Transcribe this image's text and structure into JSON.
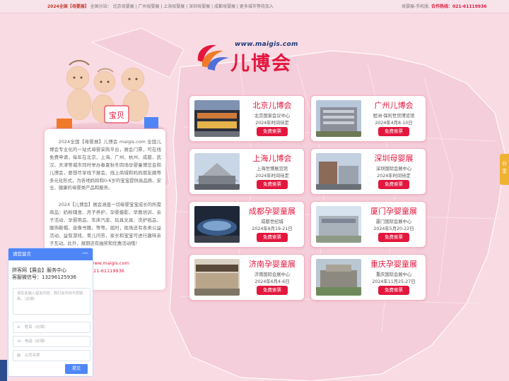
{
  "topbar": {
    "brand": "2024全国【母婴展】",
    "branches_label": "全国分站：",
    "branches": [
      "北京母婴展",
      "广州母婴展",
      "上海母婴展",
      "深圳母婴展",
      "成都母婴展",
      "更多城市等待加入"
    ],
    "mobile": "母婴展-手机版.",
    "hotline_label": "合作热线：",
    "hotline": "021-61119936"
  },
  "logo": {
    "url": "www.maigis.com",
    "name": "儿博会"
  },
  "intro": {
    "p1": "2024全国【母婴展】儿博会 maigis.com 全国儿博会专业化的一站式母婴采购平台，展会门票，可在线免费申请，每年在北京、上海、广州、杭州、成都、武汉、天津等城市同时举办春夏秋冬四场孕婴童博览会和儿博会，要想尽享线下展会、线上商城和妈妈朋友圈等多元化形式，为各地妈妈和0-6岁的宝宝提供高品质，安全、健康的母婴类产品和服务。",
    "p2": "2024【儿博会】展会涵盖一切母婴宝宝成长的所需商品：奶粉辅食、月子养护、孕婴摄影、早教培训、亲子活动、孕婴用品、车床汽座、玩具文具、洗护纸品、服饰鞋帽、音像书籍、等等。届时，现场还有各类公益活动、益智游戏、育儿问答，家长和宝宝可进行趣味亲子互动。此外，展期还有抽奖和优惠活动哦！",
    "site_url": "www.maigis.com",
    "phone": "021-61119936"
  },
  "expos": [
    {
      "title": "北京儿博会",
      "venue": "北京国家会议中心",
      "date": "2024年时间待定",
      "button": "免费索票"
    },
    {
      "title": "广州儿博会",
      "venue": "琶洲·保利世贸博览馆",
      "date": "2024年4月8-10日",
      "button": "免费索票"
    },
    {
      "title": "上海儿博会",
      "venue": "上海世博展览馆",
      "date": "2024年时间待定",
      "button": "免费索票"
    },
    {
      "title": "深圳母婴展",
      "venue": "深圳国际会展中心",
      "date": "2024年时间待定",
      "button": "免费索票"
    },
    {
      "title": "成都孕婴童展",
      "venue": "成都世纪城",
      "date": "2024年8月19-21日",
      "button": "免费索票"
    },
    {
      "title": "厦门孕婴童展",
      "venue": "厦门国际会展中心",
      "date": "2024年5月20-22日",
      "button": "免费索票"
    },
    {
      "title": "济南孕婴童展",
      "venue": "济南国际会展中心",
      "date": "2024年6月4-6日",
      "button": "免费索票"
    },
    {
      "title": "重庆孕婴童展",
      "venue": "重庆国际会展中心",
      "date": "2024年11月25-27日",
      "button": "免费索票"
    }
  ],
  "chat": {
    "header": "请您留言",
    "minimize": "—",
    "line1": "拼客网【展会】服务中心",
    "line2": "客服微信号：13296125936",
    "message_placeholder": "请在此输入留言内容，我们会尽快与您联系。（必填）",
    "name_placeholder": "姓名（必填）",
    "phone_placeholder": "电话（必填）",
    "company_placeholder": "公司名称",
    "submit": "提交"
  },
  "side_tab": "分享",
  "colors": {
    "accent": "#e3173e",
    "background": "#f9dbe4",
    "chat_blue": "#4f86f7",
    "side_tab": "#f0b232"
  },
  "icons": {
    "user": "user-icon",
    "phone": "phone-icon",
    "company": "building-icon"
  }
}
